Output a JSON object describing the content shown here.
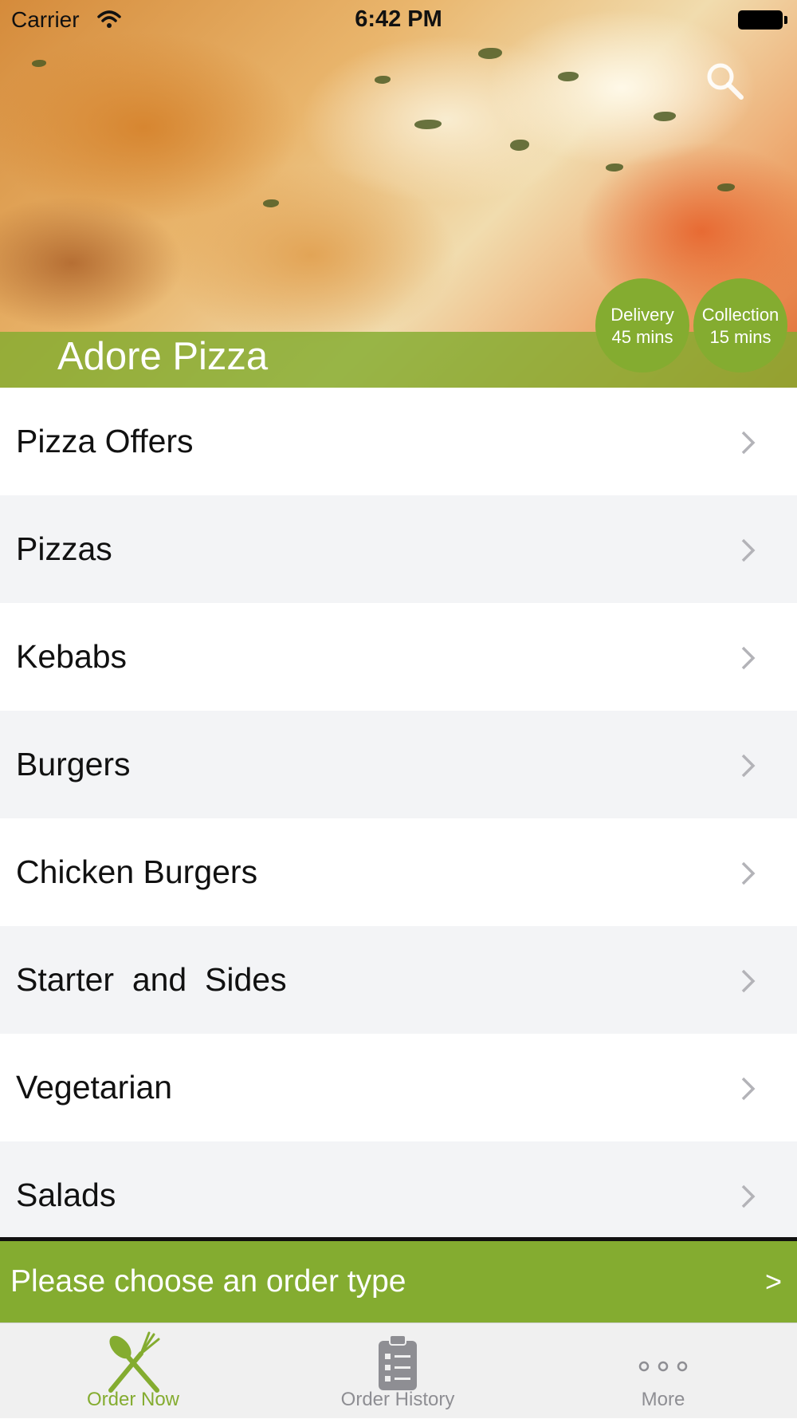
{
  "status_bar": {
    "carrier": "Carrier",
    "time": "6:42 PM"
  },
  "header": {
    "restaurant_name": "Adore Pizza",
    "delivery": {
      "label": "Delivery",
      "time": "45 mins"
    },
    "collection": {
      "label": "Collection",
      "time": "15 mins"
    },
    "search_icon": "search-icon"
  },
  "categories": [
    {
      "label": "Pizza Offers"
    },
    {
      "label": "Pizzas"
    },
    {
      "label": "Kebabs"
    },
    {
      "label": "Burgers"
    },
    {
      "label": "Chicken Burgers"
    },
    {
      "label": "Starter  and  Sides"
    },
    {
      "label": "Vegetarian"
    },
    {
      "label": "Salads"
    }
  ],
  "order_bar": {
    "label": "Please choose an order type",
    "arrow": ">"
  },
  "tabs": [
    {
      "label": "Order Now",
      "icon": "fork-knife-icon",
      "active": true
    },
    {
      "label": "Order History",
      "icon": "clipboard-icon",
      "active": false
    },
    {
      "label": "More",
      "icon": "more-dots-icon",
      "active": false
    }
  ],
  "colors": {
    "accent": "#84ac30",
    "inactive": "#8e8e93",
    "row_alt": "#f3f4f6"
  }
}
